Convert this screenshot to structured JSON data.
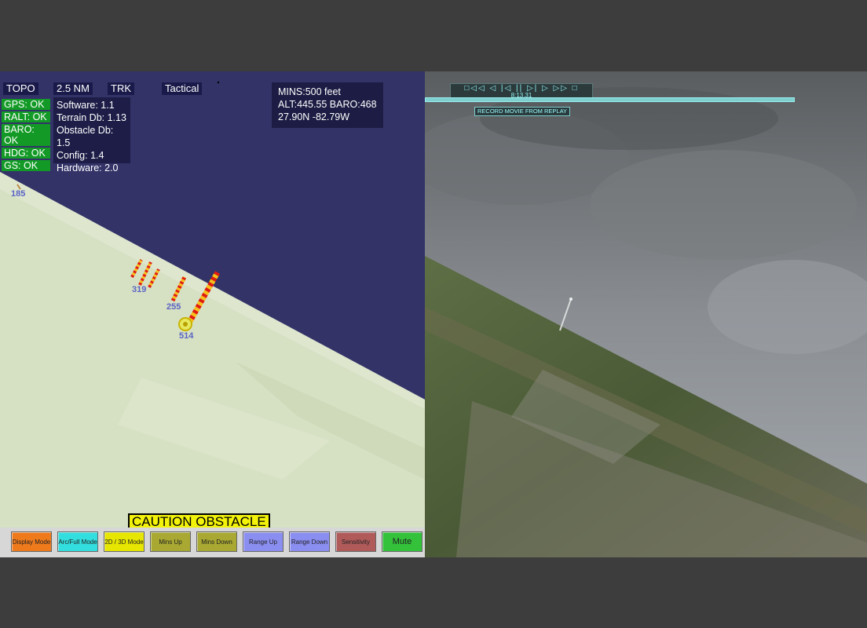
{
  "left_display": {
    "top_labels": [
      "TOPO",
      "2.5 NM",
      "TRK",
      "Tactical"
    ],
    "status": [
      "GPS:  OK",
      "RALT: OK",
      "BARO: OK",
      "HDG: OK",
      "GS: OK"
    ],
    "info": [
      "Software: 1.1",
      "Terrain Db: 1.13",
      "Obstacle Db: 1.5",
      "Config: 1.4",
      "Hardware: 2.0"
    ],
    "mins": [
      "MINS:500 feet",
      "ALT:445.55 BARO:468",
      "27.90N -82.79W"
    ],
    "obstacle_labels": [
      "185",
      "319",
      "255",
      "514"
    ],
    "caution": "CAUTION OBSTACLE",
    "buttons": [
      {
        "label": "Display Mode",
        "color": "#ee7a1c"
      },
      {
        "label": "Arc/Full Mode",
        "color": "#33dede"
      },
      {
        "label": "2D / 3D Mode",
        "color": "#e6e600"
      },
      {
        "label": "Mins Up",
        "color": "#a8a832"
      },
      {
        "label": "Mins Down",
        "color": "#a8a832"
      },
      {
        "label": "Range Up",
        "color": "#8a8ef0"
      },
      {
        "label": "Range Down",
        "color": "#8a8ef0"
      },
      {
        "label": "Sensitivity",
        "color": "#b05a5a"
      },
      {
        "label": "Mute",
        "color": "#33c23a"
      }
    ]
  },
  "replay": {
    "controls": "□◁◁ ◁ |◁ || ▷| ▷ ▷▷ □",
    "time": "8:13.31",
    "record_label": "RECORD MOVIE FROM REPLAY"
  },
  "colors": {
    "sky": "#333368",
    "terrain": "#d6e0c3",
    "caution": "#f2f20a",
    "status_ok": "#139a26"
  }
}
